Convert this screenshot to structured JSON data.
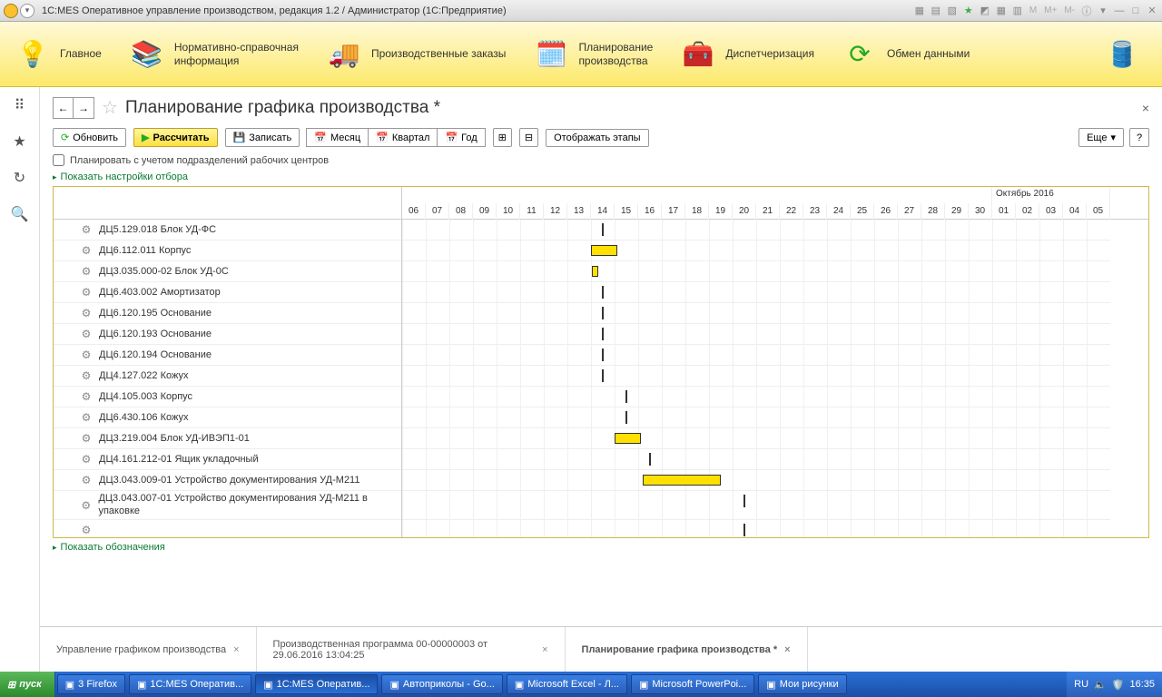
{
  "titlebar": {
    "text": "1С:MES Оперативное управление производством, редакция 1.2 / Администратор  (1С:Предприятие)",
    "m_labels": [
      "M",
      "M+",
      "M-"
    ]
  },
  "main_menu": [
    {
      "label": "Главное"
    },
    {
      "label": "Нормативно-справочная\nинформация"
    },
    {
      "label": "Производственные заказы"
    },
    {
      "label": "Планирование\nпроизводства"
    },
    {
      "label": "Диспетчеризация"
    },
    {
      "label": "Обмен данными"
    }
  ],
  "page": {
    "title": "Планирование графика производства *",
    "toolbar": {
      "refresh": "Обновить",
      "calculate": "Рассчитать",
      "save": "Записать",
      "period_month": "Месяц",
      "period_quarter": "Квартал",
      "period_year": "Год",
      "show_stages": "Отображать этапы",
      "more": "Еще",
      "help": "?"
    },
    "checkbox_label": "Планировать с учетом подразделений рабочих центров",
    "filter_link": "Показать настройки отбора",
    "legend_link": "Показать обозначения"
  },
  "gantt": {
    "month_label": "Октябрь 2016",
    "days": [
      "06",
      "07",
      "08",
      "09",
      "10",
      "11",
      "12",
      "13",
      "14",
      "15",
      "16",
      "17",
      "18",
      "19",
      "20",
      "21",
      "22",
      "23",
      "24",
      "25",
      "26",
      "27",
      "28",
      "29",
      "30",
      "01",
      "02",
      "03",
      "04",
      "05"
    ],
    "rows": [
      {
        "label": "ДЦ5.129.018 Блок УД-ФС",
        "tick": 8
      },
      {
        "label": "ДЦ6.112.011 Корпус",
        "bar_start": 8,
        "bar_len": 1.1
      },
      {
        "label": "ДЦ3.035.000-02 Блок УД-0С",
        "bar_start": 8.05,
        "bar_len": 0.25
      },
      {
        "label": "ДЦ6.403.002 Амортизатор",
        "tick": 8
      },
      {
        "label": "ДЦ6.120.195 Основание",
        "tick": 8
      },
      {
        "label": "ДЦ6.120.193 Основание",
        "tick": 8
      },
      {
        "label": "ДЦ6.120.194 Основание",
        "tick": 8
      },
      {
        "label": "ДЦ4.127.022 Кожух",
        "tick": 8
      },
      {
        "label": "ДЦ4.105.003 Корпус",
        "tick": 9
      },
      {
        "label": "ДЦ6.430.106 Кожух",
        "tick": 9
      },
      {
        "label": "ДЦ3.219.004 Блок УД-ИВЭП1-01",
        "bar_start": 9,
        "bar_len": 1.1
      },
      {
        "label": "ДЦ4.161.212-01 Ящик укладочный",
        "tick": 10
      },
      {
        "label": "ДЦ3.043.009-01 Устройство документирования УД-М211",
        "bar_start": 10.2,
        "bar_len": 3.3
      },
      {
        "label": "ДЦ3.043.007-01 Устройство документирования УД-М211 в упаковке",
        "tick": 14
      },
      {
        "label": "",
        "tick": 14
      }
    ]
  },
  "footer_tabs": [
    {
      "label": "Управление графиком производства"
    },
    {
      "label": "Производственная программа 00-00000003 от 29.06.2016 13:04:25"
    },
    {
      "label": "Планирование графика производства *",
      "active": true
    }
  ],
  "taskbar": {
    "start": "пуск",
    "items": [
      {
        "label": "3 Firefox"
      },
      {
        "label": "1С:MES Оператив..."
      },
      {
        "label": "1С:MES Оператив...",
        "active": true
      },
      {
        "label": "Автоприколы - Go..."
      },
      {
        "label": "Microsoft Excel - Л..."
      },
      {
        "label": "Microsoft PowerPoi..."
      },
      {
        "label": "Мои рисунки"
      }
    ],
    "lang": "RU",
    "time": "16:35"
  }
}
